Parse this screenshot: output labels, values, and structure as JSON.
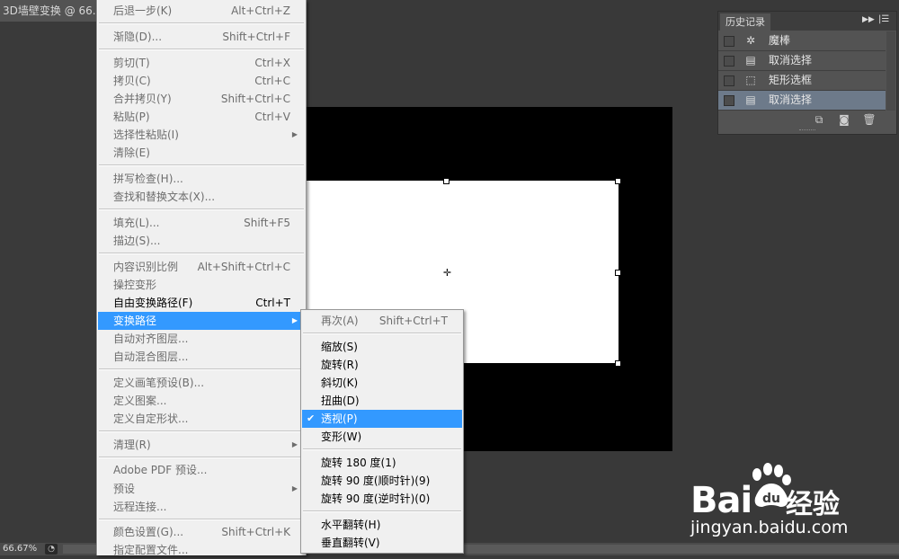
{
  "document": {
    "tab_title": "3D墙壁变换 @ 66.",
    "zoom": "66.67%"
  },
  "edit_menu": {
    "items": [
      {
        "label": "后退一步(K)",
        "shortcut": "Alt+Ctrl+Z"
      },
      {
        "label": "渐隐(D)...",
        "shortcut": "Shift+Ctrl+F"
      },
      {
        "label": "剪切(T)",
        "shortcut": "Ctrl+X"
      },
      {
        "label": "拷贝(C)",
        "shortcut": "Ctrl+C"
      },
      {
        "label": "合并拷贝(Y)",
        "shortcut": "Shift+Ctrl+C"
      },
      {
        "label": "粘贴(P)",
        "shortcut": "Ctrl+V"
      },
      {
        "label": "选择性粘贴(I)",
        "shortcut": ""
      },
      {
        "label": "清除(E)",
        "shortcut": ""
      },
      {
        "label": "拼写检查(H)...",
        "shortcut": ""
      },
      {
        "label": "查找和替换文本(X)...",
        "shortcut": ""
      },
      {
        "label": "填充(L)...",
        "shortcut": "Shift+F5"
      },
      {
        "label": "描边(S)...",
        "shortcut": ""
      },
      {
        "label": "内容识别比例",
        "shortcut": "Alt+Shift+Ctrl+C"
      },
      {
        "label": "操控变形",
        "shortcut": ""
      },
      {
        "label": "自由变换路径(F)",
        "shortcut": "Ctrl+T"
      },
      {
        "label": "变换路径",
        "shortcut": ""
      },
      {
        "label": "自动对齐图层...",
        "shortcut": ""
      },
      {
        "label": "自动混合图层...",
        "shortcut": ""
      },
      {
        "label": "定义画笔预设(B)...",
        "shortcut": ""
      },
      {
        "label": "定义图案...",
        "shortcut": ""
      },
      {
        "label": "定义自定形状...",
        "shortcut": ""
      },
      {
        "label": "清理(R)",
        "shortcut": ""
      },
      {
        "label": "Adobe PDF 预设...",
        "shortcut": ""
      },
      {
        "label": "预设",
        "shortcut": ""
      },
      {
        "label": "远程连接...",
        "shortcut": ""
      },
      {
        "label": "颜色设置(G)...",
        "shortcut": "Shift+Ctrl+K"
      },
      {
        "label": "指定配置文件...",
        "shortcut": ""
      }
    ]
  },
  "transform_submenu": {
    "items": [
      {
        "label": "再次(A)",
        "shortcut": "Shift+Ctrl+T"
      },
      {
        "label": "缩放(S)",
        "shortcut": ""
      },
      {
        "label": "旋转(R)",
        "shortcut": ""
      },
      {
        "label": "斜切(K)",
        "shortcut": ""
      },
      {
        "label": "扭曲(D)",
        "shortcut": ""
      },
      {
        "label": "透视(P)",
        "shortcut": ""
      },
      {
        "label": "变形(W)",
        "shortcut": ""
      },
      {
        "label": "旋转 180 度(1)",
        "shortcut": ""
      },
      {
        "label": "旋转 90 度(顺时针)(9)",
        "shortcut": ""
      },
      {
        "label": "旋转 90 度(逆时针)(0)",
        "shortcut": ""
      },
      {
        "label": "水平翻转(H)",
        "shortcut": ""
      },
      {
        "label": "垂直翻转(V)",
        "shortcut": ""
      }
    ],
    "checked_label": "✔"
  },
  "history_panel": {
    "tab": "历史记录",
    "collapse_icon": "double-arrow-right-icon",
    "menu_icon": "panel-menu-icon",
    "items": [
      {
        "label": "魔棒",
        "icon": "magic-wand-icon"
      },
      {
        "label": "取消选择",
        "icon": "document-icon"
      },
      {
        "label": "矩形选框",
        "icon": "marquee-icon"
      },
      {
        "label": "取消选择",
        "icon": "document-icon"
      }
    ]
  },
  "watermark": {
    "brand": "Bai",
    "brand2": "经验",
    "url": "jingyan.baidu.com"
  },
  "colors": {
    "menu_highlight": "#3399ff",
    "history_active": "#6d7a8a"
  }
}
